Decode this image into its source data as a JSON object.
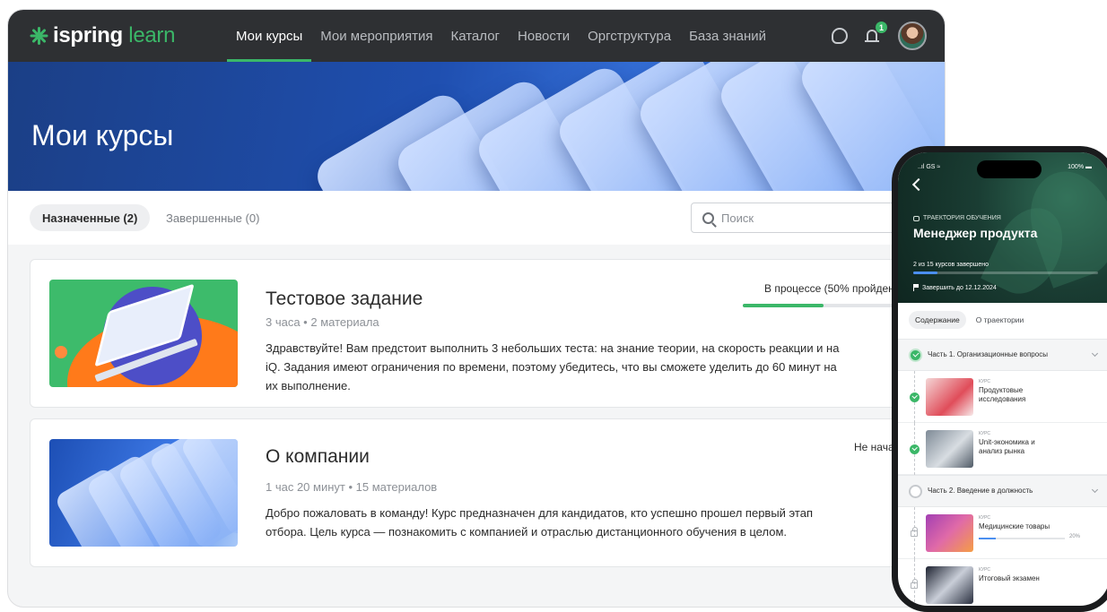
{
  "brand": {
    "name_part1": "ispring",
    "name_part2": "learn",
    "accent": "#3bb768"
  },
  "nav": {
    "items": [
      {
        "label": "Мои курсы",
        "active": true
      },
      {
        "label": "Мои мероприятия"
      },
      {
        "label": "Каталог"
      },
      {
        "label": "Новости"
      },
      {
        "label": "Оргструктура"
      },
      {
        "label": "База знаний"
      }
    ],
    "notification_count": "1",
    "icons": [
      "chat-icon",
      "bell-icon",
      "avatar"
    ]
  },
  "hero": {
    "title": "Мои курсы"
  },
  "tabs": [
    {
      "label": "Назначенные (2)",
      "active": true
    },
    {
      "label": "Завершенные (0)"
    }
  ],
  "search": {
    "placeholder": "Поиск",
    "value": ""
  },
  "courses": [
    {
      "title": "Тестовое задание",
      "meta": "3 часа • 2 материала",
      "description": "Здравствуйте! Вам предстоит выполнить 3 небольших теста: на знание теории, на скорость реакции и на iQ. Задания имеют ограничения по времени, поэтому убедитесь, что вы сможете уделить до 60 минут на их выполнение.",
      "status": "В процессе (50% пройден",
      "progress": 0.5
    },
    {
      "title": "О компании",
      "meta": "1 час 20 минут • 15 материалов",
      "description": "Добро пожаловать в команду! Курс предназначен для кандидатов, кто успешно прошел первый этап отбора. Цель курса — познакомить с компанией и отраслью дистанционного обучения в целом.",
      "status": "Не нача"
    }
  ],
  "phone": {
    "status_left": "..ıl GS ≈",
    "status_right": "100% ▬",
    "kind": "ТРАЕКТОРИЯ ОБУЧЕНИЯ",
    "title": "Менеджер продукта",
    "progress_text": "2 из 15 курсов завершено",
    "progress": 0.133,
    "deadline": "Завершить до 12.12.2024",
    "tabs": [
      {
        "label": "Содержание",
        "active": true
      },
      {
        "label": "О траектории"
      }
    ],
    "sections": [
      {
        "title": "Часть 1. Организационные вопросы",
        "done": true
      },
      {
        "title": "Часть 2. Введение в должность",
        "done": false
      }
    ],
    "items": [
      {
        "kind": "КУРС",
        "name": "Продуктовые исследования",
        "state": "done"
      },
      {
        "kind": "КУРС",
        "name": "Unit-экономика и анализ рынка",
        "state": "done"
      },
      {
        "kind": "КУРС",
        "name": "Медицинские товары",
        "state": "locked",
        "progress": 0.2,
        "progress_label": "20%"
      },
      {
        "kind": "КУРС",
        "name": "Итоговый экзамен",
        "state": "locked"
      }
    ]
  }
}
